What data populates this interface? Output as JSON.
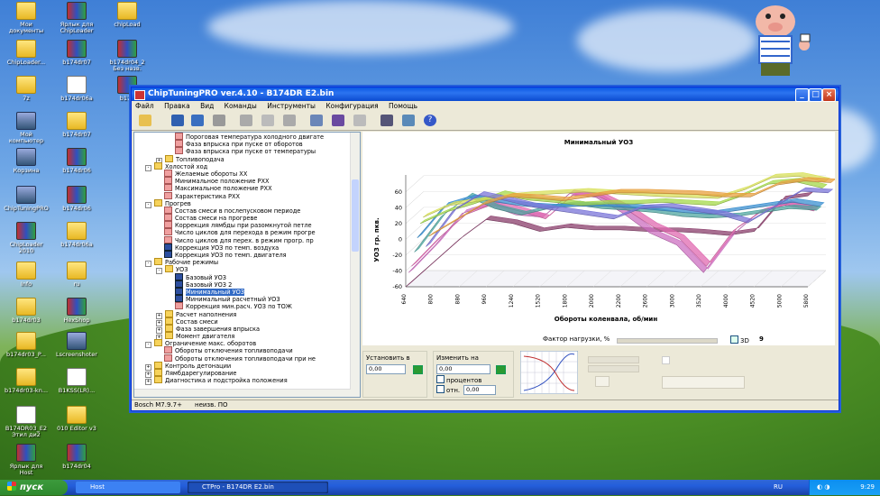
{
  "window": {
    "title": "ChipTuningPRO ver.4.10 - B174DR E2.bin",
    "menu": [
      "Файл",
      "Правка",
      "Вид",
      "Команды",
      "Инструменты",
      "Конфигурация",
      "Помощь"
    ],
    "status_left": "Bosch M7.9.7+",
    "status_right": "неизв. ПО"
  },
  "tree": [
    {
      "level": 3,
      "icon": "p",
      "label": "Пороговая температура холодного двигате"
    },
    {
      "level": 3,
      "icon": "p",
      "label": "Фаза впрыска при пуске от оборотов"
    },
    {
      "level": 3,
      "icon": "p",
      "label": "Фаза впрыска при пуске от температуры"
    },
    {
      "level": 2,
      "icon": "f",
      "exp": "+",
      "label": "Топливоподача"
    },
    {
      "level": 1,
      "icon": "f",
      "exp": "-",
      "label": "Холостой ход"
    },
    {
      "level": 2,
      "icon": "p",
      "label": "Желаемые обороты ХХ"
    },
    {
      "level": 2,
      "icon": "p",
      "label": "Минимальное положение РХХ"
    },
    {
      "level": 2,
      "icon": "p",
      "label": "Максимальное положение РХХ"
    },
    {
      "level": 2,
      "icon": "p",
      "label": "Характеристика РХХ"
    },
    {
      "level": 1,
      "icon": "f",
      "exp": "-",
      "label": "Прогрев"
    },
    {
      "level": 2,
      "icon": "p",
      "label": "Состав смеси в послепусковом периоде"
    },
    {
      "level": 2,
      "icon": "p",
      "label": "Состав смеси на прогреве"
    },
    {
      "level": 2,
      "icon": "p",
      "label": "Коррекция лямбды при разомкнутой петле"
    },
    {
      "level": 2,
      "icon": "p",
      "label": "Число циклов для перехода в режим прогре"
    },
    {
      "level": 2,
      "icon": "p",
      "label": "Число циклов для перех. в режим прогр. пр"
    },
    {
      "level": 2,
      "icon": "b",
      "label": "Коррекция УОЗ по темп. воздуха"
    },
    {
      "level": 2,
      "icon": "b",
      "label": "Коррекция УОЗ по темп. двигателя"
    },
    {
      "level": 1,
      "icon": "f",
      "exp": "-",
      "label": "Рабочие режимы"
    },
    {
      "level": 2,
      "icon": "f",
      "exp": "-",
      "label": "УОЗ"
    },
    {
      "level": 3,
      "icon": "b",
      "label": "Базовый УОЗ"
    },
    {
      "level": 3,
      "icon": "b",
      "label": "Базовый УОЗ 2"
    },
    {
      "level": 3,
      "icon": "b",
      "label": "Минимальный УОЗ",
      "selected": true
    },
    {
      "level": 3,
      "icon": "b",
      "label": "Минимальный расчетный УОЗ"
    },
    {
      "level": 3,
      "icon": "p",
      "label": "Коррекция мин.расч. УОЗ по ТОЖ"
    },
    {
      "level": 2,
      "icon": "f",
      "exp": "+",
      "label": "Расчет наполнения"
    },
    {
      "level": 2,
      "icon": "f",
      "exp": "+",
      "label": "Состав смеси"
    },
    {
      "level": 2,
      "icon": "f",
      "exp": "+",
      "label": "Фаза завершения впрыска"
    },
    {
      "level": 2,
      "icon": "f",
      "exp": "+",
      "label": "Момент двигателя"
    },
    {
      "level": 1,
      "icon": "f",
      "exp": "-",
      "label": "Ограничение макс. оборотов"
    },
    {
      "level": 2,
      "icon": "p",
      "label": "Обороты отключения топливоподачи"
    },
    {
      "level": 2,
      "icon": "p",
      "label": "Обороты отключения топливоподачи при не"
    },
    {
      "level": 1,
      "icon": "f",
      "exp": "+",
      "label": "Контроль детонации"
    },
    {
      "level": 1,
      "icon": "f",
      "exp": "+",
      "label": "Лямбдарегулирование"
    },
    {
      "level": 1,
      "icon": "f",
      "exp": "+",
      "label": "Диагностика и подстройка положения"
    }
  ],
  "controls": {
    "load_factor_label": "Фактор нагрузки, %",
    "check_3d": "3D",
    "load_index": "9",
    "set_label": "Установить в",
    "set_value": "0,00",
    "change_label": "Изменить на",
    "change_value": "0,00",
    "percent_label": "процентов",
    "percent_value": "0,000",
    "rel_label": "отн.",
    "rel_value": "0,00"
  },
  "colors": {
    "title_bar": "#0a58e3",
    "accent": "#316ac5"
  },
  "chart_data": {
    "type": "line",
    "title": "Минимальный УОЗ",
    "xlabel": "Обороты коленвала, об/мин",
    "ylabel": "УОЗ гр. пкв.",
    "x": [
      640,
      800,
      880,
      960,
      1240,
      1520,
      1800,
      2000,
      2200,
      2600,
      3000,
      3520,
      4000,
      4520,
      5000,
      5800
    ],
    "yticks": [
      60,
      40,
      20,
      0,
      -20,
      -40,
      -60
    ],
    "ylim": [
      -60,
      70
    ],
    "series": [
      {
        "color": "#8a3d6b",
        "values": [
          -60,
          -30,
          0,
          25,
          20,
          10,
          15,
          12,
          12,
          10,
          10,
          8,
          5,
          10,
          50,
          55
        ]
      },
      {
        "color": "#cc6fc0",
        "values": [
          -45,
          -10,
          30,
          40,
          28,
          25,
          55,
          50,
          30,
          5,
          -10,
          -45,
          0,
          30,
          40,
          35
        ]
      },
      {
        "color": "#e06ab0",
        "values": [
          -40,
          -5,
          25,
          38,
          30,
          20,
          50,
          48,
          32,
          10,
          -5,
          -40,
          5,
          28,
          38,
          30
        ]
      },
      {
        "color": "#4fa5a0",
        "values": [
          -25,
          20,
          45,
          30,
          22,
          30,
          35,
          30,
          28,
          25,
          20,
          18,
          20,
          25,
          30,
          28
        ]
      },
      {
        "color": "#3a8fd0",
        "values": [
          -10,
          30,
          40,
          35,
          30,
          28,
          30,
          30,
          28,
          25,
          22,
          20,
          25,
          30,
          35,
          30
        ]
      },
      {
        "color": "#a4d84a",
        "values": [
          5,
          20,
          30,
          42,
          35,
          32,
          28,
          30,
          30,
          32,
          30,
          28,
          40,
          55,
          58,
          50
        ]
      },
      {
        "color": "#d8e05a",
        "values": [
          10,
          25,
          30,
          35,
          38,
          40,
          42,
          40,
          38,
          36,
          35,
          34,
          45,
          60,
          62,
          55
        ]
      },
      {
        "color": "#7a74d8",
        "values": [
          -30,
          15,
          35,
          28,
          20,
          15,
          10,
          5,
          18,
          20,
          15,
          10,
          0,
          20,
          40,
          38
        ]
      },
      {
        "color": "#e8a040",
        "values": [
          -20,
          0,
          20,
          30,
          28,
          25,
          30,
          35,
          35,
          34,
          33,
          30,
          30,
          45,
          50,
          48
        ]
      }
    ]
  }
}
